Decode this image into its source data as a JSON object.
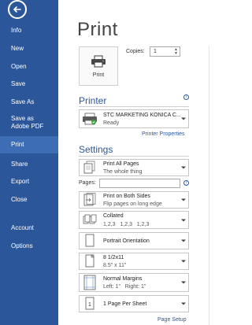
{
  "nav": {
    "items": [
      {
        "label": "Info",
        "active": false
      },
      {
        "label": "New",
        "active": false
      },
      {
        "label": "Open",
        "active": false
      },
      {
        "label": "Save",
        "active": false
      },
      {
        "label": "Save As",
        "active": false
      },
      {
        "label": "Save as Adobe PDF",
        "active": false
      },
      {
        "label": "Print",
        "active": true
      },
      {
        "label": "Share",
        "active": false
      },
      {
        "label": "Export",
        "active": false
      },
      {
        "label": "Close",
        "active": false
      },
      {
        "label": "Account",
        "active": false
      },
      {
        "label": "Options",
        "active": false
      }
    ]
  },
  "main": {
    "title": "Print",
    "print_button_label": "Print",
    "copies_label": "Copies:",
    "copies_value": "1",
    "printer_heading": "Printer",
    "printer_name": "STC MARKETING KONICA C...",
    "printer_status": "Ready",
    "printer_properties_link": "Printer Properties",
    "settings_heading": "Settings",
    "settings": {
      "pages_scope": {
        "title": "Print All Pages",
        "sub": "The whole thing"
      },
      "pages_label": "Pages:",
      "sides": {
        "title": "Print on Both Sides",
        "sub": "Flip pages on long edge"
      },
      "collation": {
        "title": "Collated",
        "sub": "1,2,3   1,2,3   1,2,3"
      },
      "orientation": {
        "title": "Portrait Orientation"
      },
      "paper": {
        "title": "8 1/2x11",
        "sub": "8.5\" x 11\""
      },
      "margins": {
        "title": "Normal Margins",
        "sub": "Left: 1\"   Right: 1\""
      },
      "per_sheet": {
        "title": "1 Page Per Sheet"
      }
    },
    "page_setup_link": "Page Setup"
  },
  "colors": {
    "accent": "#2b579a",
    "nav_active": "#3d6eb5"
  }
}
